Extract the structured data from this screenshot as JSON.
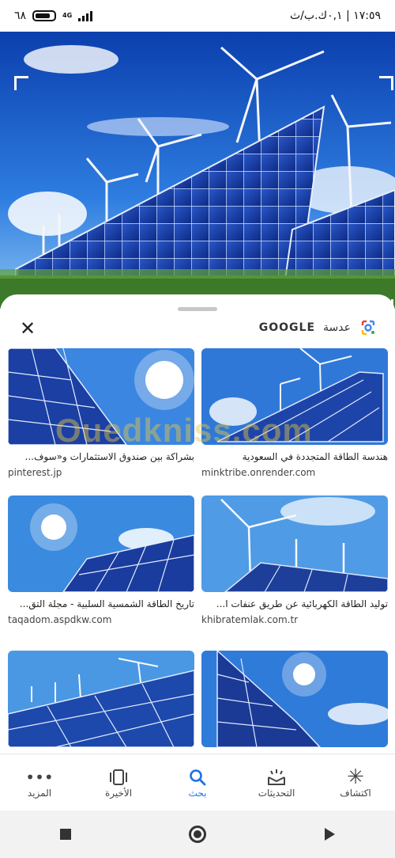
{
  "status_bar": {
    "time": "١٧:٥٩ | ٠,١ك.ب/ث",
    "battery": "٦٨",
    "network": "4G"
  },
  "sheet": {
    "brand": "GOOGLE",
    "lens_label": "عدسة"
  },
  "results": [
    {
      "title": "هندسة الطاقة المتجددة في السعودية",
      "source": "minktribe.onrender.com"
    },
    {
      "title": "بشراكة بين صندوق الاستثمارات و«سوف...",
      "source": "pinterest.jp"
    },
    {
      "title": "توليد الطاقة الكهربائية عن طريق عنفات ا...",
      "source": "khibratemlak.com.tr"
    },
    {
      "title": "تاريخ الطاقة الشمسية السلبية - مجلة التق...",
      "source": "taqadom.aspdkw.com"
    }
  ],
  "watermark": "Ouedkniss.com",
  "bottom_nav": {
    "discover": "اكتشاف",
    "updates": "التحديثات",
    "search": "بحث",
    "recent": "الأخيرة",
    "more": "المزيد"
  }
}
